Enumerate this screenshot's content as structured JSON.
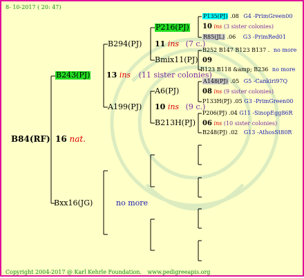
{
  "header": {
    "date": "8- 10-2017 ( 20: 47)"
  },
  "footer": {
    "copyright": "Copyright 2004-2017 @ Karl Kehrle Foundation.",
    "url": "www.pedigreeapis.org"
  },
  "root": {
    "name": "B84(RF)",
    "gen": "16",
    "ins": "nat",
    "dot": "."
  },
  "father": {
    "name": "B243(PJ)"
  },
  "father_info": {
    "gen": "13",
    "ins": "ins",
    "note": "(11 sister colonies)"
  },
  "mother": {
    "name": "Bxx16(JG)",
    "note": "no more"
  },
  "ff": {
    "name": "B294(PJ)"
  },
  "ff_info": {
    "gen": "11",
    "ins": "ins",
    "note": "(7 c.)"
  },
  "fm": {
    "name": "A199(PJ)"
  },
  "fm_info": {
    "gen": "10",
    "ins": "ins",
    "note": "(9 c.)"
  },
  "fff": {
    "name": "P216(PJ)"
  },
  "ffm": {
    "name": "Bmix11(PJ)"
  },
  "fmf": {
    "name": "A6(PJ)"
  },
  "fmm": {
    "name": "B213H(PJ)"
  },
  "right": {
    "r1": {
      "name": "P135(PJ)",
      "num": ".08",
      "line": "G4 -PrimGreen00"
    },
    "r2": {
      "gen": "10",
      "ins": "ins",
      "note": "(3 sister colonies)"
    },
    "r3": {
      "name": "R85(JL)",
      "num": ".06",
      "line": "G3 -PrimRed01"
    },
    "r4": {
      "text": "B252 B147 B123 B137 .",
      "note": "no more"
    },
    "r5": {
      "gen": "09"
    },
    "r6": {
      "text": "B123 B118 &amp; B236",
      "note": "no more"
    },
    "r7": {
      "name": "A148(PJ)",
      "num": ".05",
      "line": "G5 -Cankiri97Q"
    },
    "r8": {
      "gen": "08",
      "ins": "ins",
      "note": "(9 sister colonies)"
    },
    "r9": {
      "name": "P133H(PJ)",
      "num": ".05",
      "line": "G3 -PrimGreen00"
    },
    "r10": {
      "name": "P206(PJ)",
      "num": ".04",
      "line": "G11 -SinopEgg86R"
    },
    "r11": {
      "gen": "06",
      "ins": "ins",
      "note": "(10 sister colonies)"
    },
    "r12": {
      "name": "B248(PJ)",
      "num": ".02",
      "line": "G13 -AthosSt80R"
    }
  },
  "colors": {
    "border": "#e0109a",
    "background": "#ffffc8",
    "highlight_cyan": "#00ffff",
    "highlight_green": "#22dd22",
    "highlight_gray": "#c8c8c8"
  }
}
